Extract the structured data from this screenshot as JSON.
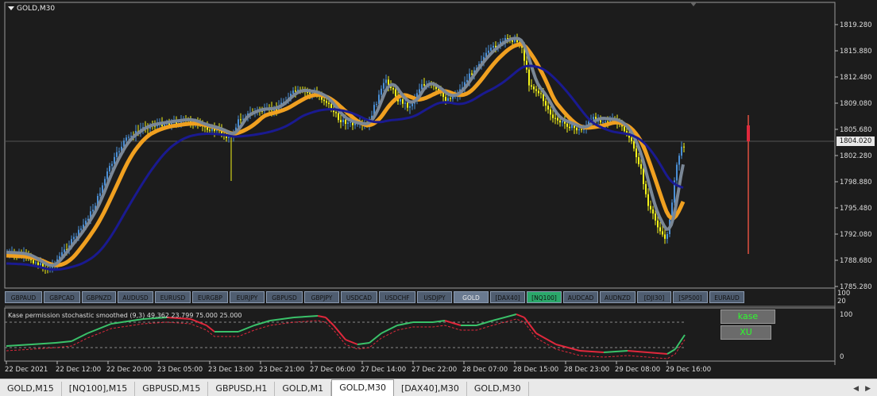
{
  "chart": {
    "title": "GOLD,M30",
    "current_price": "1804.020",
    "price_axis": [
      "1819.280",
      "1815.880",
      "1812.480",
      "1809.080",
      "1805.680",
      "1802.280",
      "1798.880",
      "1795.480",
      "1792.080",
      "1788.680",
      "1785.280"
    ],
    "time_axis": [
      "22 Dec 2021",
      "22 Dec 12:00",
      "22 Dec 20:00",
      "23 Dec 05:00",
      "23 Dec 13:00",
      "23 Dec 21:00",
      "27 Dec 06:00",
      "27 Dec 14:00",
      "27 Dec 22:00",
      "28 Dec 07:00",
      "28 Dec 15:00",
      "28 Dec 23:00",
      "29 Dec 08:00",
      "29 Dec 16:00"
    ],
    "colors": {
      "bull": "#4a8fd6",
      "bear": "#f5f51a",
      "ma_orange": "#f0a020",
      "ma_gray": "#7a8796",
      "ma_navy": "#1a1a90",
      "stoch_green": "#3ac26a",
      "stoch_red": "#e0283c",
      "signal": "#e0283c",
      "volume_line": "#e05040"
    }
  },
  "symbol_bar": [
    {
      "label": "GBPAUD",
      "w": 47
    },
    {
      "label": "GBPCAD",
      "w": 46
    },
    {
      "label": "GBPNZD",
      "w": 43
    },
    {
      "label": "AUDUSD",
      "w": 45
    },
    {
      "label": "EURUSD",
      "w": 45
    },
    {
      "label": "EURGBP",
      "w": 45
    },
    {
      "label": "EURJPY",
      "w": 44
    },
    {
      "label": "GBPUSD",
      "w": 46
    },
    {
      "label": "GBPJPY",
      "w": 44
    },
    {
      "label": "USDCAD",
      "w": 46
    },
    {
      "label": "USDCHF",
      "w": 46
    },
    {
      "label": "USDJPY",
      "w": 44
    },
    {
      "label": "GOLD",
      "w": 44,
      "state": "active"
    },
    {
      "label": "[DAX40]",
      "w": 44
    },
    {
      "label": "[NQ100]",
      "w": 44,
      "state": "green"
    },
    {
      "label": "AUDCAD",
      "w": 44
    },
    {
      "label": "AUDNZD",
      "w": 45
    },
    {
      "label": "[DJI30]",
      "w": 43
    },
    {
      "label": "[SP500]",
      "w": 44
    },
    {
      "label": "EURAUD",
      "w": 44
    }
  ],
  "indicator": {
    "label": "Kase permission stochastic smoothed (9,3) 49.362 23.799 75.000 25.000",
    "axis_top": "100",
    "axis_bottom": "0",
    "divider_top": "100",
    "divider_bottom": "20",
    "buttons": {
      "kase": "kase",
      "xu": "XU"
    }
  },
  "tabs": [
    {
      "label": "GOLD,M15"
    },
    {
      "label": "[NQ100],M15"
    },
    {
      "label": "GBPUSD,M15"
    },
    {
      "label": "GBPUSD,H1"
    },
    {
      "label": "GOLD,M1"
    },
    {
      "label": "GOLD,M30",
      "active": true
    },
    {
      "label": "[DAX40],M30"
    },
    {
      "label": "GOLD,M30"
    }
  ],
  "tab_arrows": {
    "left": "◀",
    "right": "▶"
  }
}
